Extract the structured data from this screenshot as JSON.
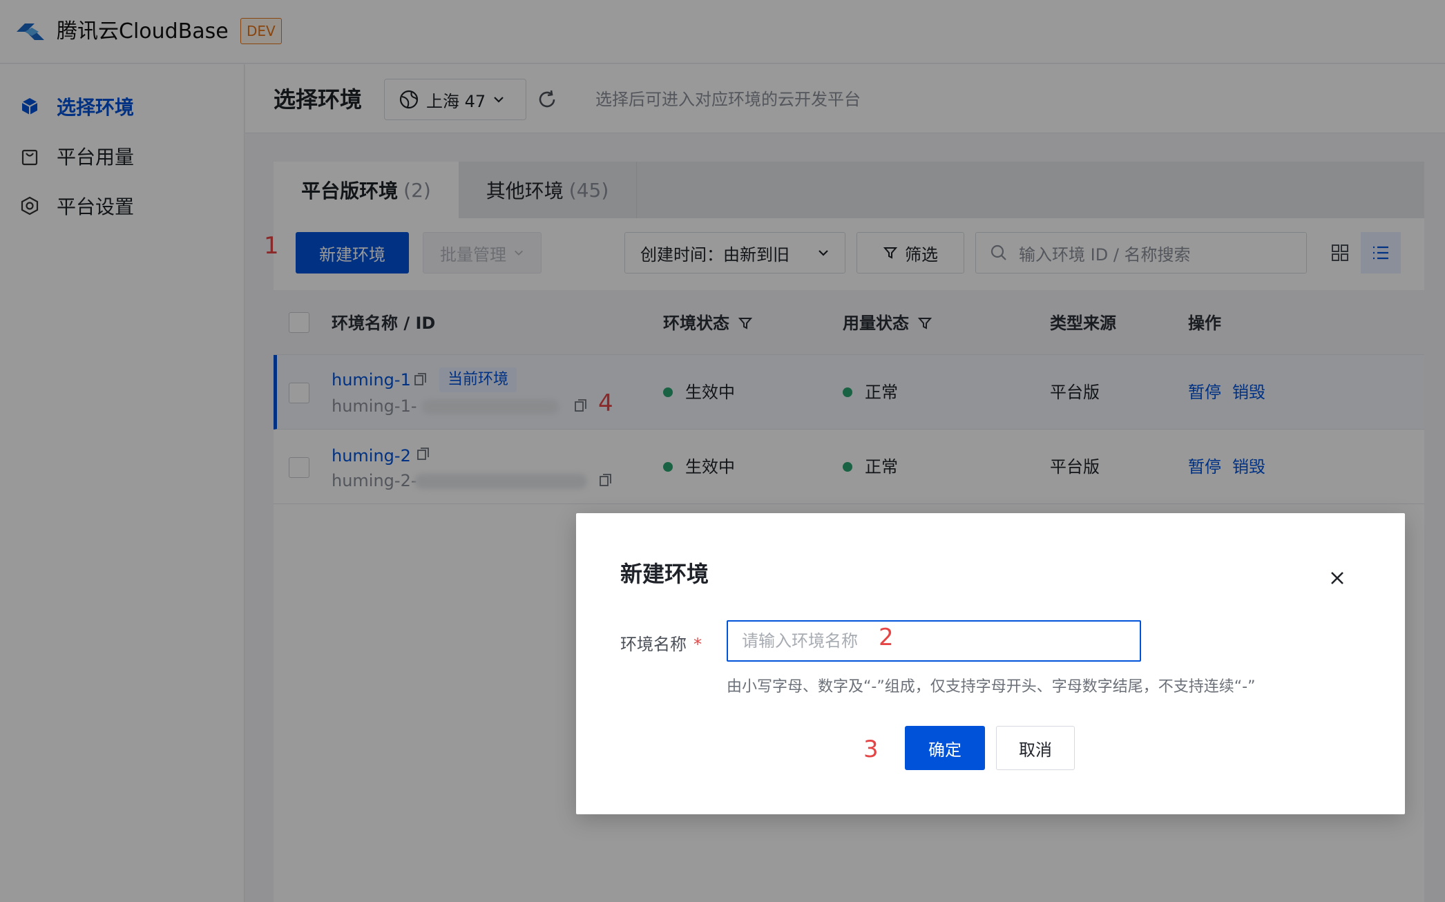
{
  "app": {
    "name": "腾讯云CloudBase",
    "env_badge": "DEV"
  },
  "sidebar": {
    "items": [
      {
        "label": "选择环境",
        "icon": "cube-icon",
        "active": true
      },
      {
        "label": "平台用量",
        "icon": "bag-icon",
        "active": false
      },
      {
        "label": "平台设置",
        "icon": "hex-settings-icon",
        "active": false
      }
    ]
  },
  "header": {
    "title": "选择环境",
    "region": "上海 47",
    "hint": "选择后可进入对应环境的云开发平台"
  },
  "tabs": [
    {
      "label": "平台版环境",
      "count": "(2)",
      "active": true
    },
    {
      "label": "其他环境",
      "count": "(45)",
      "active": false
    }
  ],
  "toolbar": {
    "new_env": "新建环境",
    "batch": "批量管理",
    "sort": "创建时间：由新到旧",
    "filter": "筛选",
    "search_placeholder": "输入环境 ID / 名称搜索"
  },
  "table": {
    "columns": [
      "环境名称 / ID",
      "环境状态",
      "用量状态",
      "类型来源",
      "操作"
    ],
    "rows": [
      {
        "name": "huming-1",
        "id_prefix": "huming-1-",
        "tag": "当前环境",
        "status": "生效中",
        "usage": "正常",
        "source": "平台版",
        "pause": "暂停",
        "destroy": "销毁"
      },
      {
        "name": "huming-2",
        "id_prefix": "huming-2-",
        "status": "生效中",
        "usage": "正常",
        "source": "平台版",
        "pause": "暂停",
        "destroy": "销毁"
      }
    ]
  },
  "steps": [
    "1",
    "2",
    "3",
    "4"
  ],
  "modal": {
    "title": "新建环境",
    "field_label": "环境名称",
    "required_mark": "*",
    "placeholder": "请输入环境名称",
    "helper": "由小写字母、数字及“-”组成，仅支持字母开头、字母数字结尾，不支持连续“-”",
    "confirm": "确定",
    "cancel": "取消"
  },
  "colors": {
    "primary": "#0052d9",
    "success": "#2ba471",
    "annotation": "#e54545",
    "badge": "#e37318"
  }
}
